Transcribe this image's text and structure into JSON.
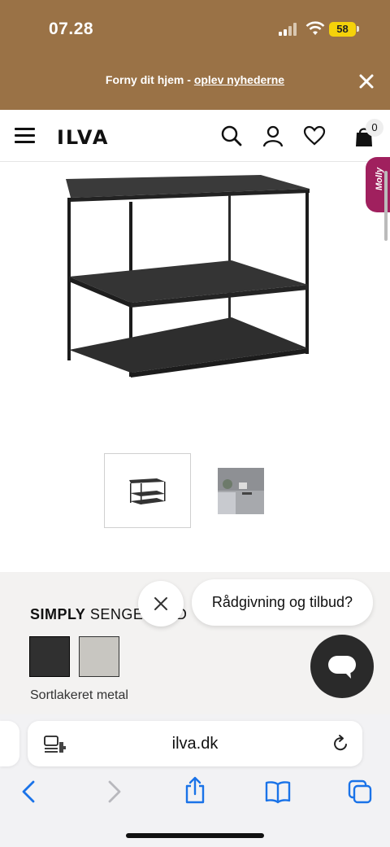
{
  "status_bar": {
    "time": "07.28",
    "battery": "58"
  },
  "promo": {
    "text": "Forny dit hjem - ",
    "link": "oplev nyhederne"
  },
  "header": {
    "logo": "ILVA",
    "cart_count": "0"
  },
  "molly_tab": "Molly",
  "product": {
    "title_bold": "SIMPLY",
    "title_rest": " SENGEBORD",
    "color_name": "Sortlakeret metal",
    "swatches": [
      "#303030",
      "#c8c6c1"
    ]
  },
  "chat": {
    "bubble_text": "Rådgivning og tilbud?"
  },
  "browser": {
    "url": "ilva.dk"
  },
  "colors": {
    "promo_bg": "#9a7246",
    "molly_bg": "#a0205e",
    "safari_accent": "#1a73e8"
  }
}
